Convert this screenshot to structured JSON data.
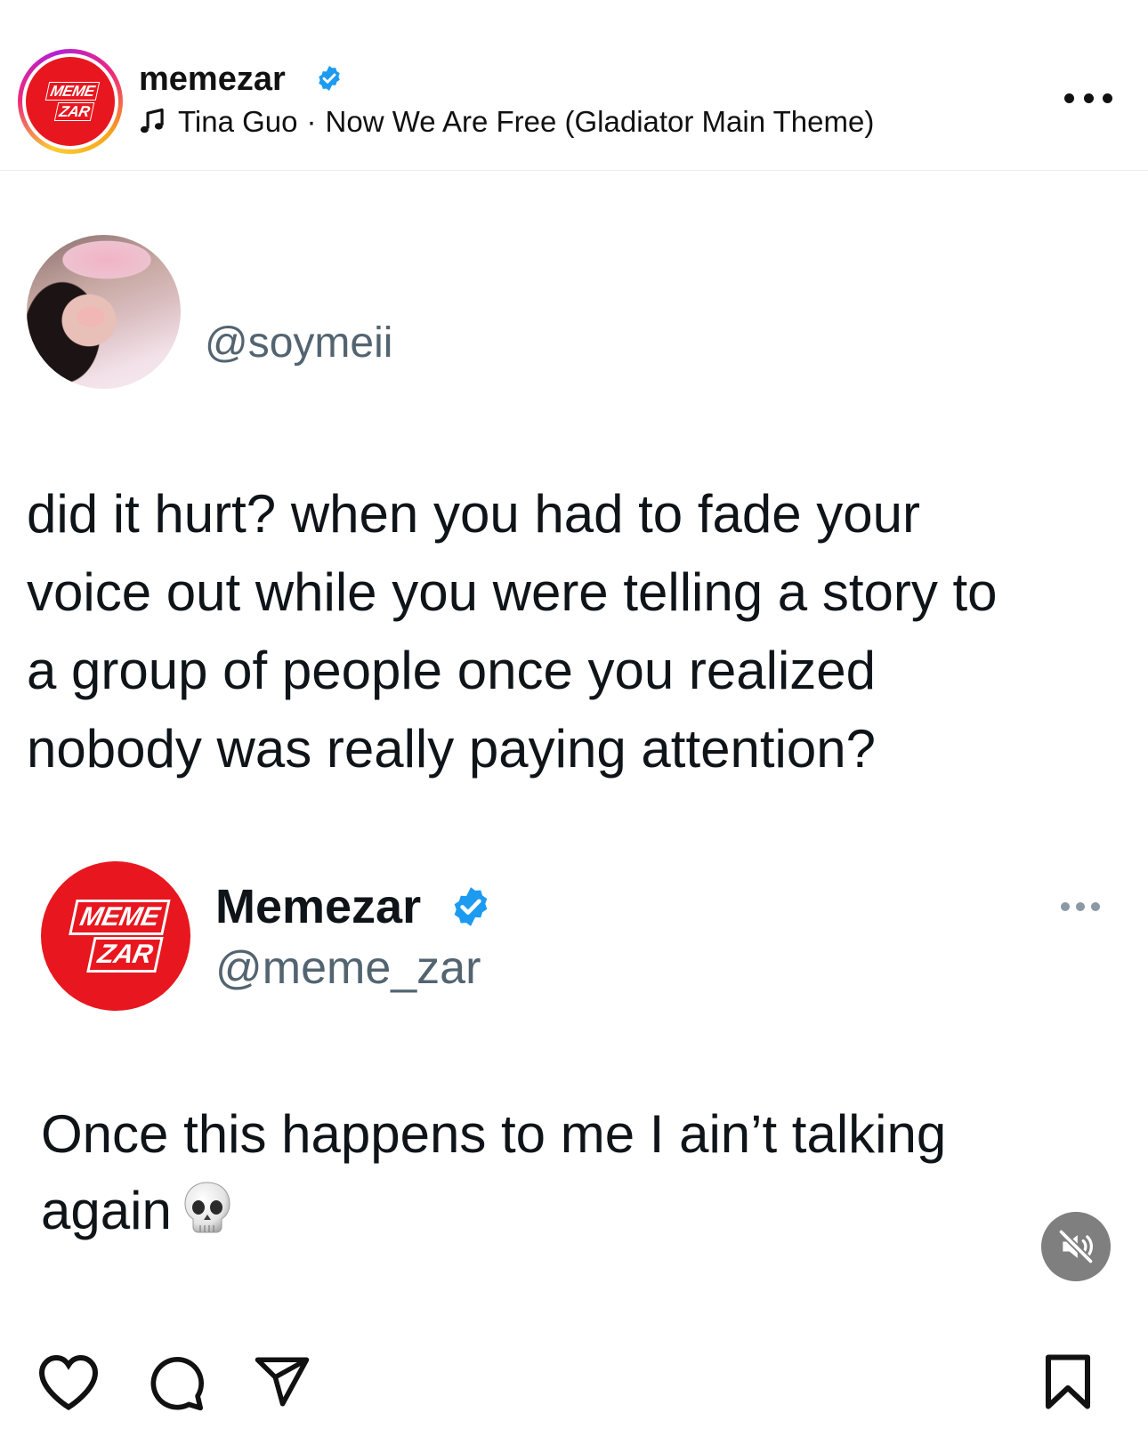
{
  "header": {
    "username": "memezar",
    "verified": true,
    "music_artist": "Tina Guo",
    "music_separator": "·",
    "music_title": "Now We Are Free (Gladiator Main Theme)",
    "logo_line1": "MEME",
    "logo_line2": "ZAR"
  },
  "original_tweet": {
    "handle": "@soymeii",
    "text_lines": [
      "did it hurt? when you had to fade your",
      "voice out while you were telling a story to",
      "a group of people once you realized",
      "nobody was really paying attention?"
    ]
  },
  "reply_tweet": {
    "display_name": "Memezar",
    "handle": "@meme_zar",
    "logo_line1": "MEME",
    "logo_line2": "ZAR",
    "text_lines": [
      "Once this happens to me I ain’t talking",
      "again"
    ],
    "emoji": "skull"
  },
  "colors": {
    "brand_red": "#e8171f",
    "verified_blue": "#1d9bf0",
    "secondary_text": "#536471",
    "mute_button": "#7f7f7f"
  },
  "icons": [
    "music-note-icon",
    "verified-badge-icon",
    "more-options-icon",
    "mute-icon",
    "heart-icon",
    "comment-icon",
    "share-icon",
    "bookmark-icon"
  ]
}
